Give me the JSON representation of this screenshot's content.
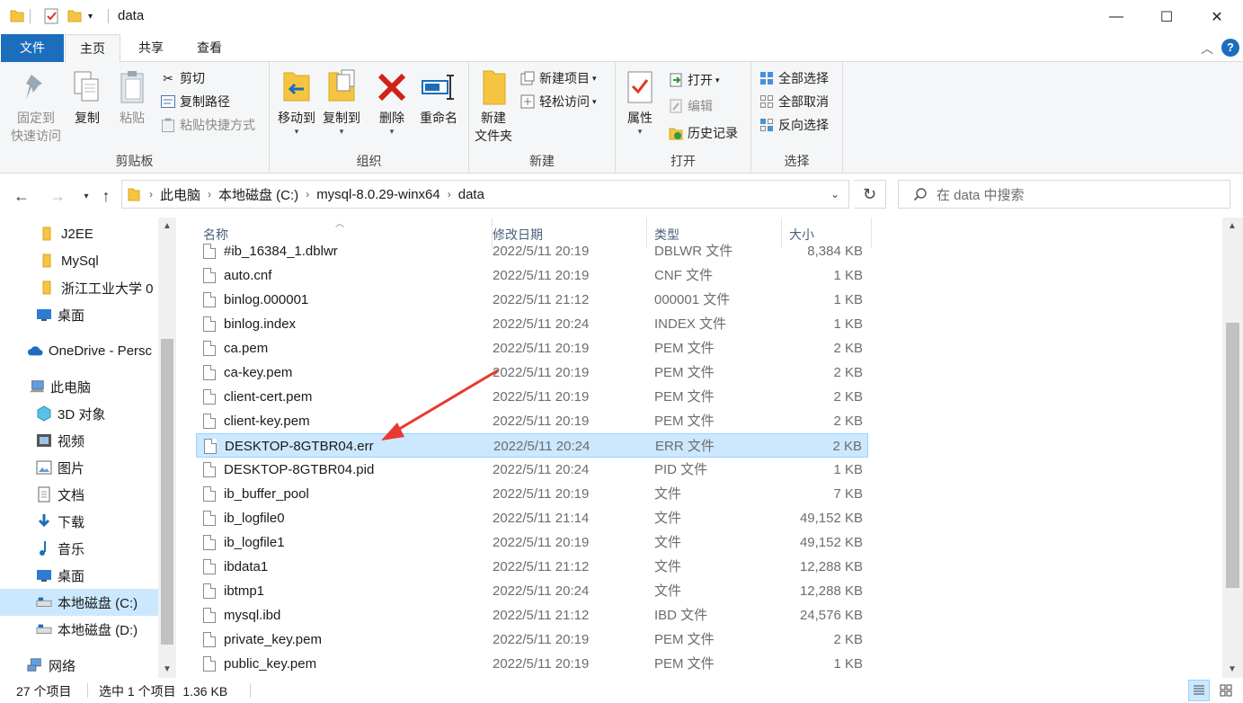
{
  "window": {
    "title": "data",
    "minimize": "—",
    "maximize": "☐",
    "close": "✕"
  },
  "tabs": {
    "file": "文件",
    "home": "主页",
    "share": "共享",
    "view": "查看"
  },
  "ribbon": {
    "clipboard": {
      "label": "剪贴板",
      "pin_line1": "固定到",
      "pin_line2": "快速访问",
      "copy": "复制",
      "paste": "粘贴",
      "cut": "剪切",
      "copy_path": "复制路径",
      "paste_shortcut": "粘贴快捷方式"
    },
    "organize": {
      "label": "组织",
      "move_to": "移动到",
      "copy_to": "复制到",
      "delete": "删除",
      "rename": "重命名"
    },
    "new": {
      "label": "新建",
      "new_folder_line1": "新建",
      "new_folder_line2": "文件夹",
      "new_item": "新建项目",
      "easy_access": "轻松访问"
    },
    "open": {
      "label": "打开",
      "properties": "属性",
      "open": "打开",
      "edit": "编辑",
      "history": "历史记录"
    },
    "select": {
      "label": "选择",
      "select_all": "全部选择",
      "select_none": "全部取消",
      "invert": "反向选择"
    }
  },
  "address": {
    "crumbs": [
      "此电脑",
      "本地磁盘 (C:)",
      "mysql-8.0.29-winx64",
      "data"
    ],
    "search_placeholder": "在 data 中搜索"
  },
  "nav_pane": {
    "items": [
      {
        "label": "J2EE",
        "icon": "folder-icon"
      },
      {
        "label": "MySql",
        "icon": "folder-icon"
      },
      {
        "label": "浙江工业大学 0",
        "icon": "folder-icon"
      },
      {
        "label": "桌面",
        "icon": "desktop-icon"
      },
      {
        "label": "OneDrive - Persc",
        "icon": "cloud-icon"
      },
      {
        "label": "此电脑",
        "icon": "computer-icon"
      },
      {
        "label": "3D 对象",
        "icon": "cube-icon"
      },
      {
        "label": "视频",
        "icon": "video-icon"
      },
      {
        "label": "图片",
        "icon": "picture-icon"
      },
      {
        "label": "文档",
        "icon": "document-icon"
      },
      {
        "label": "下载",
        "icon": "download-icon"
      },
      {
        "label": "音乐",
        "icon": "music-icon"
      },
      {
        "label": "桌面",
        "icon": "desktop-icon"
      },
      {
        "label": "本地磁盘 (C:)",
        "icon": "drive-icon"
      },
      {
        "label": "本地磁盘 (D:)",
        "icon": "drive-icon"
      },
      {
        "label": "网络",
        "icon": "network-icon"
      }
    ]
  },
  "columns": {
    "name": "名称",
    "date": "修改日期",
    "type": "类型",
    "size": "大小"
  },
  "files": [
    {
      "name": "#ib_16384_1.dblwr",
      "date": "2022/5/11 20:19",
      "type": "DBLWR 文件",
      "size": "8,384 KB"
    },
    {
      "name": "auto.cnf",
      "date": "2022/5/11 20:19",
      "type": "CNF 文件",
      "size": "1 KB"
    },
    {
      "name": "binlog.000001",
      "date": "2022/5/11 21:12",
      "type": "000001 文件",
      "size": "1 KB"
    },
    {
      "name": "binlog.index",
      "date": "2022/5/11 20:24",
      "type": "INDEX 文件",
      "size": "1 KB"
    },
    {
      "name": "ca.pem",
      "date": "2022/5/11 20:19",
      "type": "PEM 文件",
      "size": "2 KB"
    },
    {
      "name": "ca-key.pem",
      "date": "2022/5/11 20:19",
      "type": "PEM 文件",
      "size": "2 KB"
    },
    {
      "name": "client-cert.pem",
      "date": "2022/5/11 20:19",
      "type": "PEM 文件",
      "size": "2 KB"
    },
    {
      "name": "client-key.pem",
      "date": "2022/5/11 20:19",
      "type": "PEM 文件",
      "size": "2 KB"
    },
    {
      "name": "DESKTOP-8GTBR04.err",
      "date": "2022/5/11 20:24",
      "type": "ERR 文件",
      "size": "2 KB",
      "selected": true
    },
    {
      "name": "DESKTOP-8GTBR04.pid",
      "date": "2022/5/11 20:24",
      "type": "PID 文件",
      "size": "1 KB"
    },
    {
      "name": "ib_buffer_pool",
      "date": "2022/5/11 20:19",
      "type": "文件",
      "size": "7 KB"
    },
    {
      "name": "ib_logfile0",
      "date": "2022/5/11 21:14",
      "type": "文件",
      "size": "49,152 KB"
    },
    {
      "name": "ib_logfile1",
      "date": "2022/5/11 20:19",
      "type": "文件",
      "size": "49,152 KB"
    },
    {
      "name": "ibdata1",
      "date": "2022/5/11 21:12",
      "type": "文件",
      "size": "12,288 KB"
    },
    {
      "name": "ibtmp1",
      "date": "2022/5/11 20:24",
      "type": "文件",
      "size": "12,288 KB"
    },
    {
      "name": "mysql.ibd",
      "date": "2022/5/11 21:12",
      "type": "IBD 文件",
      "size": "24,576 KB"
    },
    {
      "name": "private_key.pem",
      "date": "2022/5/11 20:19",
      "type": "PEM 文件",
      "size": "2 KB"
    },
    {
      "name": "public_key.pem",
      "date": "2022/5/11 20:19",
      "type": "PEM 文件",
      "size": "1 KB"
    }
  ],
  "status": {
    "item_count": "27 个项目",
    "selection": "选中 1 个项目  1.36 KB"
  },
  "colors": {
    "accent": "#1c6ebd",
    "selection": "#cce8ff",
    "annotation_arrow": "#e8392f"
  }
}
